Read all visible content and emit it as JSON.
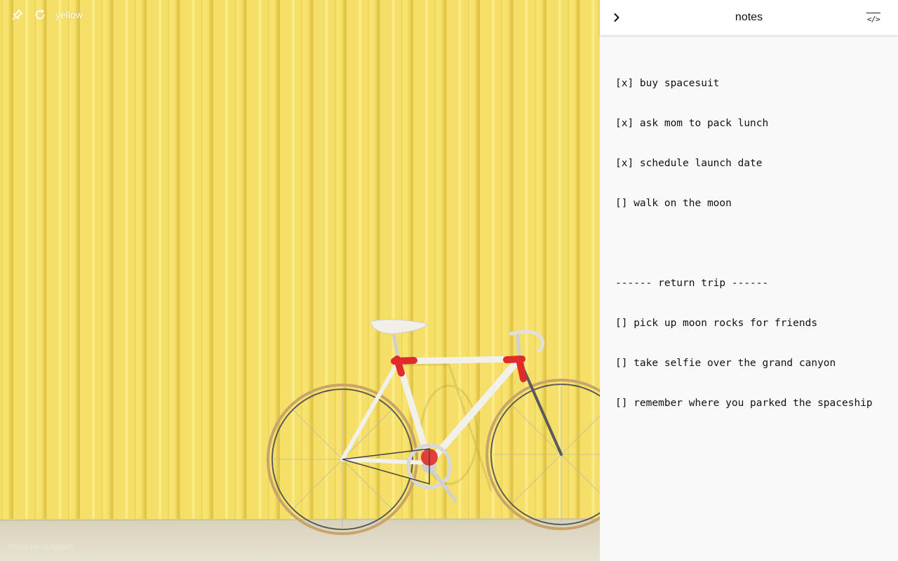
{
  "background": {
    "label": "yellow",
    "pin_icon": "pin-icon",
    "refresh_icon": "refresh-icon",
    "photo_credit": "Photo by Unsplash",
    "colors": {
      "wall": "#f6e06a",
      "ground": "#dcd7c4",
      "frame": "#f2f0ea",
      "accent_red": "#e12b2b"
    }
  },
  "notes": {
    "title": "notes",
    "collapse_icon": "chevron-right-icon",
    "code_icon": "code-icon",
    "code_label": "</>",
    "lines": [
      "[x] buy spacesuit",
      "[x] ask mom to pack lunch",
      "[x] schedule launch date",
      "[] walk on the moon",
      "",
      "------ return trip ------",
      "[] pick up moon rocks for friends",
      "[] take selfie over the grand canyon",
      "[] remember where you parked the spaceship"
    ]
  }
}
